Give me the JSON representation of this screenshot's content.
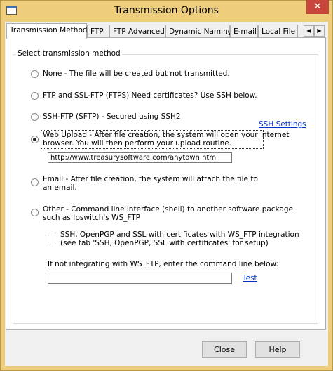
{
  "window": {
    "title": "Transmission Options",
    "close_glyph": "✕"
  },
  "tabs": [
    {
      "label": "Transmission Method",
      "active": true
    },
    {
      "label": "FTP"
    },
    {
      "label": "FTP Advanced"
    },
    {
      "label": "Dynamic Naming"
    },
    {
      "label": "E-mail"
    },
    {
      "label": "Local File"
    }
  ],
  "tab_scroll": {
    "left": "◀",
    "right": "▶"
  },
  "group": {
    "label": "Select transmission method"
  },
  "options": {
    "none": {
      "label": "None - The file will be created but not transmitted.",
      "selected": false
    },
    "ftp": {
      "label": "FTP and SSL-FTP (FTPS) Need certificates? Use SSH below.",
      "selected": false
    },
    "sftp": {
      "label": "SSH-FTP (SFTP) - Secured using SSH2",
      "selected": false
    },
    "web": {
      "line1": "Web Upload - After file creation, the system will open your internet",
      "line2": "browser.  You will then perform your upload routine.",
      "selected": true
    },
    "email": {
      "line1": "Email - After file creation, the system will attach the file to",
      "line2": "an email.",
      "selected": false
    },
    "other": {
      "line1": "Other - Command line interface (shell) to another software package",
      "line2": "such as Ipswitch's WS_FTP",
      "selected": false
    }
  },
  "ssh_settings_link": "SSH Settings",
  "web_url": "http://www.treasurysoftware.com/anytown.html",
  "ws_ftp_checkbox": {
    "line1": "SSH, OpenPGP and SSL with certificates with WS_FTP integration",
    "line2": "(see tab 'SSH, OpenPGP, SSL with certificates' for setup)",
    "checked": false
  },
  "command_line": {
    "label": "If not integrating with WS_FTP, enter the command line below:",
    "value": ""
  },
  "test_link": "Test",
  "buttons": {
    "close": "Close",
    "help": "Help"
  },
  "colors": {
    "frame": "#eecd7d",
    "close_button": "#c7473c",
    "link": "#0033cc"
  }
}
